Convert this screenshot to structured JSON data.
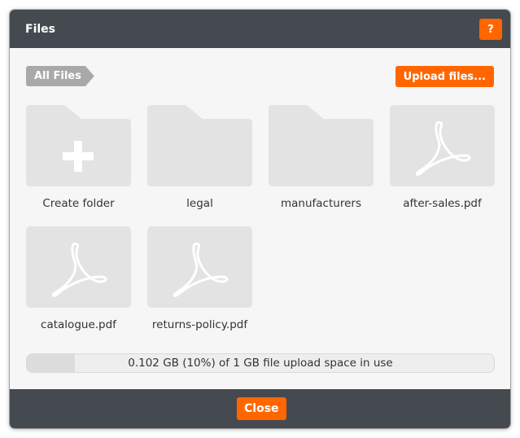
{
  "dialog": {
    "title": "Files",
    "help_label": "?"
  },
  "toolbar": {
    "breadcrumb": "All Files",
    "upload_label": "Upload files..."
  },
  "items": [
    {
      "label": "Create folder",
      "icon": "add-folder-icon"
    },
    {
      "label": "legal",
      "icon": "folder-icon"
    },
    {
      "label": "manufacturers",
      "icon": "folder-icon"
    },
    {
      "label": "after-sales.pdf",
      "icon": "pdf-icon"
    },
    {
      "label": "catalogue.pdf",
      "icon": "pdf-icon"
    },
    {
      "label": "returns-policy.pdf",
      "icon": "pdf-icon"
    }
  ],
  "storage": {
    "text": "0.102 GB (10%) of 1 GB file upload space in use",
    "used_fraction": 0.102
  },
  "footer": {
    "close_label": "Close"
  },
  "colors": {
    "accent": "#ff6600",
    "header_bg": "#454a50",
    "tile_bg": "#e3e3e3"
  }
}
